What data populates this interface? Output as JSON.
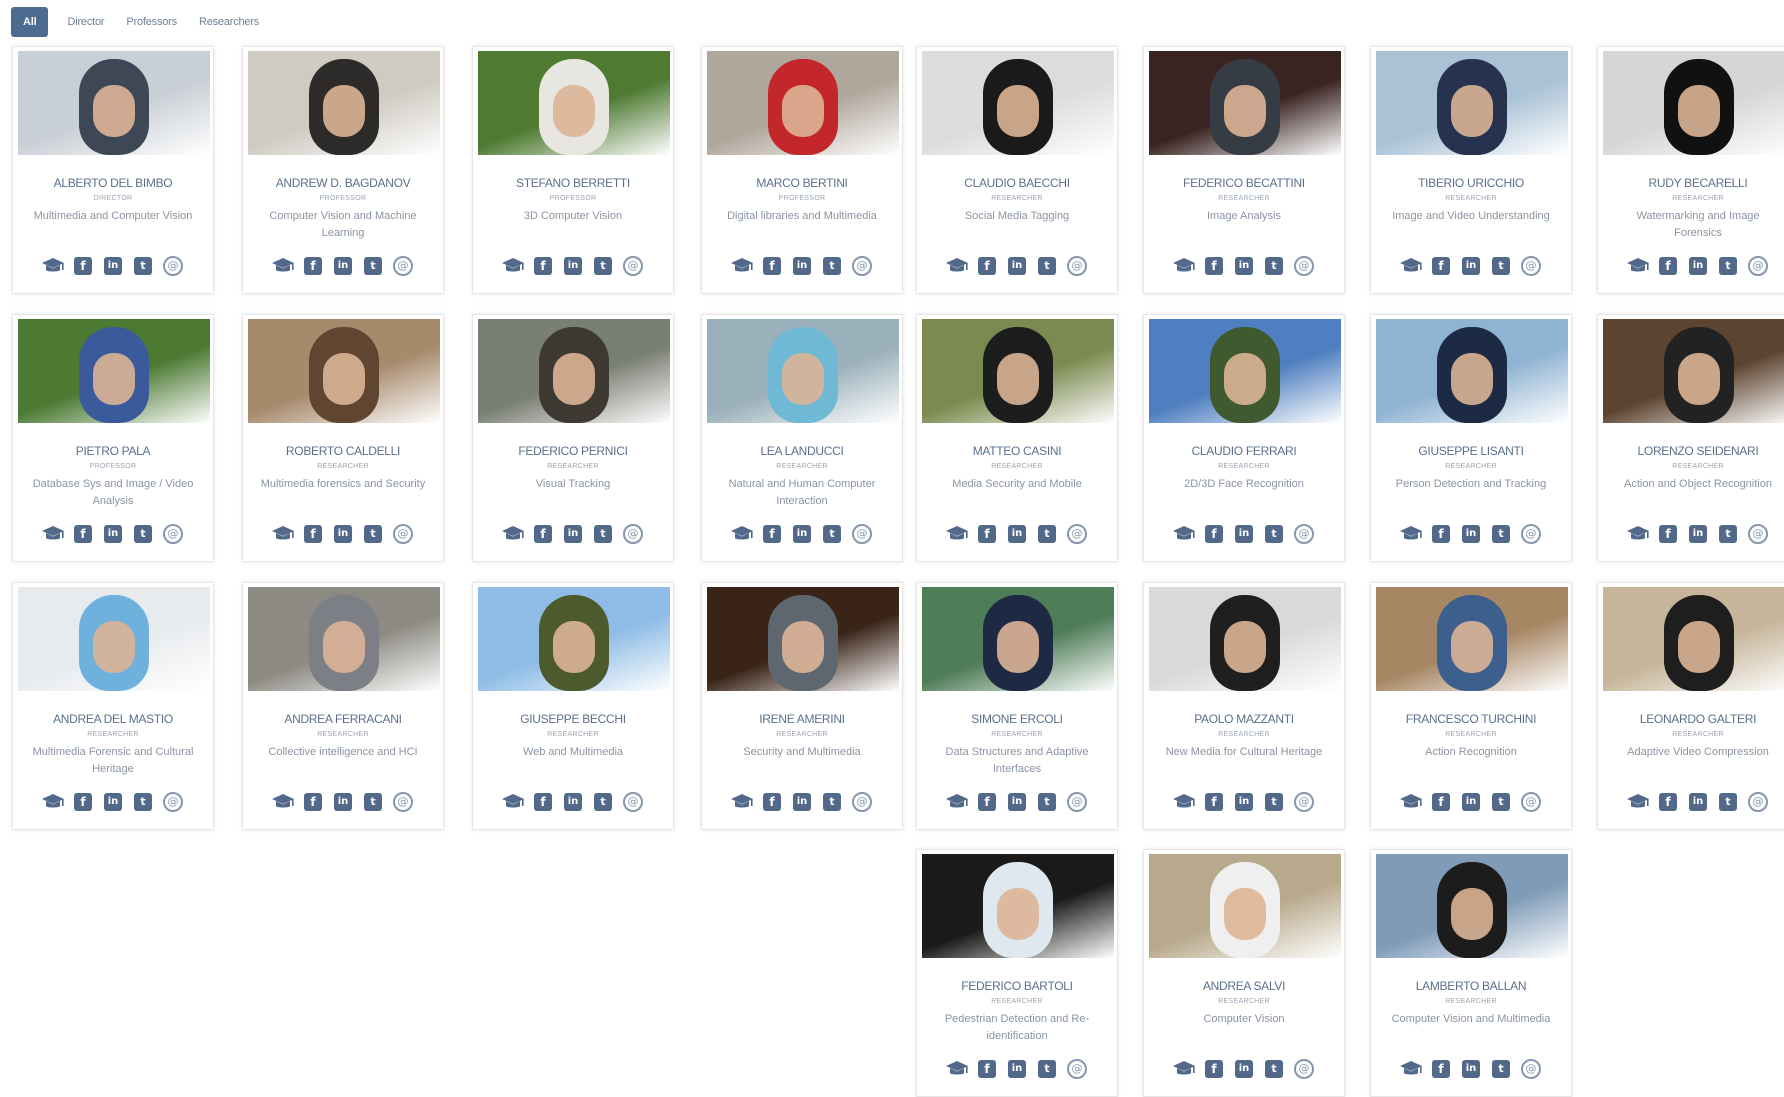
{
  "filters": {
    "tabs": [
      {
        "label": "All",
        "active": true
      },
      {
        "label": "Director",
        "active": false
      },
      {
        "label": "Professors",
        "active": false
      },
      {
        "label": "Researchers",
        "active": false
      }
    ]
  },
  "colors": {
    "accent": "#4d6b8e",
    "icon": "#53698a",
    "text": "#5b6f8c"
  },
  "social_icons": [
    "graduation-cap-icon",
    "facebook-icon",
    "linkedin-icon",
    "twitter-icon",
    "email-icon"
  ],
  "people": [
    {
      "name": "ALBERTO DEL BIMBO",
      "role": "DIRECTOR",
      "desc": "Multimedia and Computer Vision",
      "photo": [
        "#c9cfd6",
        "#3d4756"
      ]
    },
    {
      "name": "ANDREW D. BAGDANOV",
      "role": "PROFESSOR",
      "desc": "Computer Vision and Machine Learning",
      "photo": [
        "#cfcac2",
        "#2d2b29"
      ]
    },
    {
      "name": "STEFANO BERRETTI",
      "role": "PROFESSOR",
      "desc": "3D Computer Vision",
      "photo": [
        "#4e7a32",
        "#e8e6e0"
      ]
    },
    {
      "name": "MARCO BERTINI",
      "role": "PROFESSOR",
      "desc": "Digital libraries and Multimedia",
      "photo": [
        "#b0a79c",
        "#c3272b"
      ]
    },
    {
      "name": "CLAUDIO BAECCHI",
      "role": "RESEARCHER",
      "desc": "Social Media Tagging",
      "photo": [
        "#dcdcdc",
        "#1a1a1a"
      ]
    },
    {
      "name": "FEDERICO BECATTINI",
      "role": "RESEARCHER",
      "desc": "Image Analysis",
      "photo": [
        "#3a2422",
        "#363c44"
      ]
    },
    {
      "name": "TIBERIO URICCHIO",
      "role": "RESEARCHER",
      "desc": "Image and Video Understanding",
      "photo": [
        "#a9c2d6",
        "#27324f"
      ]
    },
    {
      "name": "RUDY BECARELLI",
      "role": "RESEARCHER",
      "desc": "Watermarking and Image Forensics",
      "photo": [
        "#d6d6d6",
        "#111111"
      ]
    },
    {
      "name": "PIETRO PALA",
      "role": "PROFESSOR",
      "desc": "Database Sys and Image / Video Analysis",
      "photo": [
        "#4c7a33",
        "#3b5a9c"
      ]
    },
    {
      "name": "ROBERTO CALDELLI",
      "role": "RESEARCHER",
      "desc": "Multimedia forensics and Security",
      "photo": [
        "#a78a6c",
        "#604530"
      ]
    },
    {
      "name": "FEDERICO PERNICI",
      "role": "RESEARCHER",
      "desc": "Visual Tracking",
      "photo": [
        "#7a7f73",
        "#3e3a33"
      ]
    },
    {
      "name": "LEA LANDUCCI",
      "role": "RESEARCHER",
      "desc": "Natural and Human Computer Interaction",
      "photo": [
        "#9ab0ba",
        "#6fb9d4"
      ]
    },
    {
      "name": "MATTEO CASINI",
      "role": "RESEARCHER",
      "desc": "Media Security and Mobile",
      "photo": [
        "#7b8a4e",
        "#1d1d1d"
      ]
    },
    {
      "name": "CLAUDIO FERRARI",
      "role": "RESEARCHER",
      "desc": "2D/3D Face Recognition",
      "photo": [
        "#4f7fc0",
        "#3e5a2e"
      ]
    },
    {
      "name": "GIUSEPPE LISANTI",
      "role": "RESEARCHER",
      "desc": "Person Detection and Tracking",
      "photo": [
        "#8fb3d3",
        "#1c2a44"
      ]
    },
    {
      "name": "LORENZO SEIDENARI",
      "role": "RESEARCHER",
      "desc": "Action and Object Recognition",
      "photo": [
        "#5d4430",
        "#222222"
      ]
    },
    {
      "name": "ANDREA DEL MASTIO",
      "role": "RESEARCHER",
      "desc": "Multimedia Forensic and Cultural Heritage",
      "photo": [
        "#e8ebee",
        "#6eb1dd"
      ]
    },
    {
      "name": "ANDREA FERRACANI",
      "role": "RESEARCHER",
      "desc": "Collective intelligence and HCI",
      "photo": [
        "#8c8a82",
        "#7d7f86"
      ]
    },
    {
      "name": "GIUSEPPE BECCHI",
      "role": "RESEARCHER",
      "desc": "Web and Multimedia",
      "photo": [
        "#8fbce6",
        "#4d5a2e"
      ]
    },
    {
      "name": "IRENE AMERINI",
      "role": "RESEARCHER",
      "desc": "Security and Multimedia",
      "photo": [
        "#3a2418",
        "#5e6770"
      ]
    },
    {
      "name": "SIMONE ERCOLI",
      "role": "RESEARCHER",
      "desc": "Data Structures and Adaptive Interfaces",
      "photo": [
        "#4f7d58",
        "#1e2a44"
      ]
    },
    {
      "name": "PAOLO MAZZANTI",
      "role": "RESEARCHER",
      "desc": "New Media for Cultural Heritage",
      "photo": [
        "#d9d9d9",
        "#1f1f1f"
      ]
    },
    {
      "name": "FRANCESCO TURCHINI",
      "role": "RESEARCHER",
      "desc": "Action Recognition",
      "photo": [
        "#a78664",
        "#3d5f8d"
      ]
    },
    {
      "name": "LEONARDO GALTERI",
      "role": "RESEARCHER",
      "desc": "Adaptive Video Compression",
      "photo": [
        "#c6b59a",
        "#1e1e1e"
      ]
    },
    {
      "name": "FEDERICO BARTOLI",
      "role": "RESEARCHER",
      "desc": "Pedestrian Detection and Re-identification",
      "photo": [
        "#1b1a18",
        "#dfe8ee"
      ]
    },
    {
      "name": "ANDREA SALVI",
      "role": "RESEARCHER",
      "desc": "Computer Vision",
      "photo": [
        "#b8a98c",
        "#efefef"
      ]
    },
    {
      "name": "LAMBERTO BALLAN",
      "role": "RESEARCHER",
      "desc": "Computer Vision and Multimedia",
      "photo": [
        "#7f9bb8",
        "#1c1c1c"
      ]
    }
  ]
}
